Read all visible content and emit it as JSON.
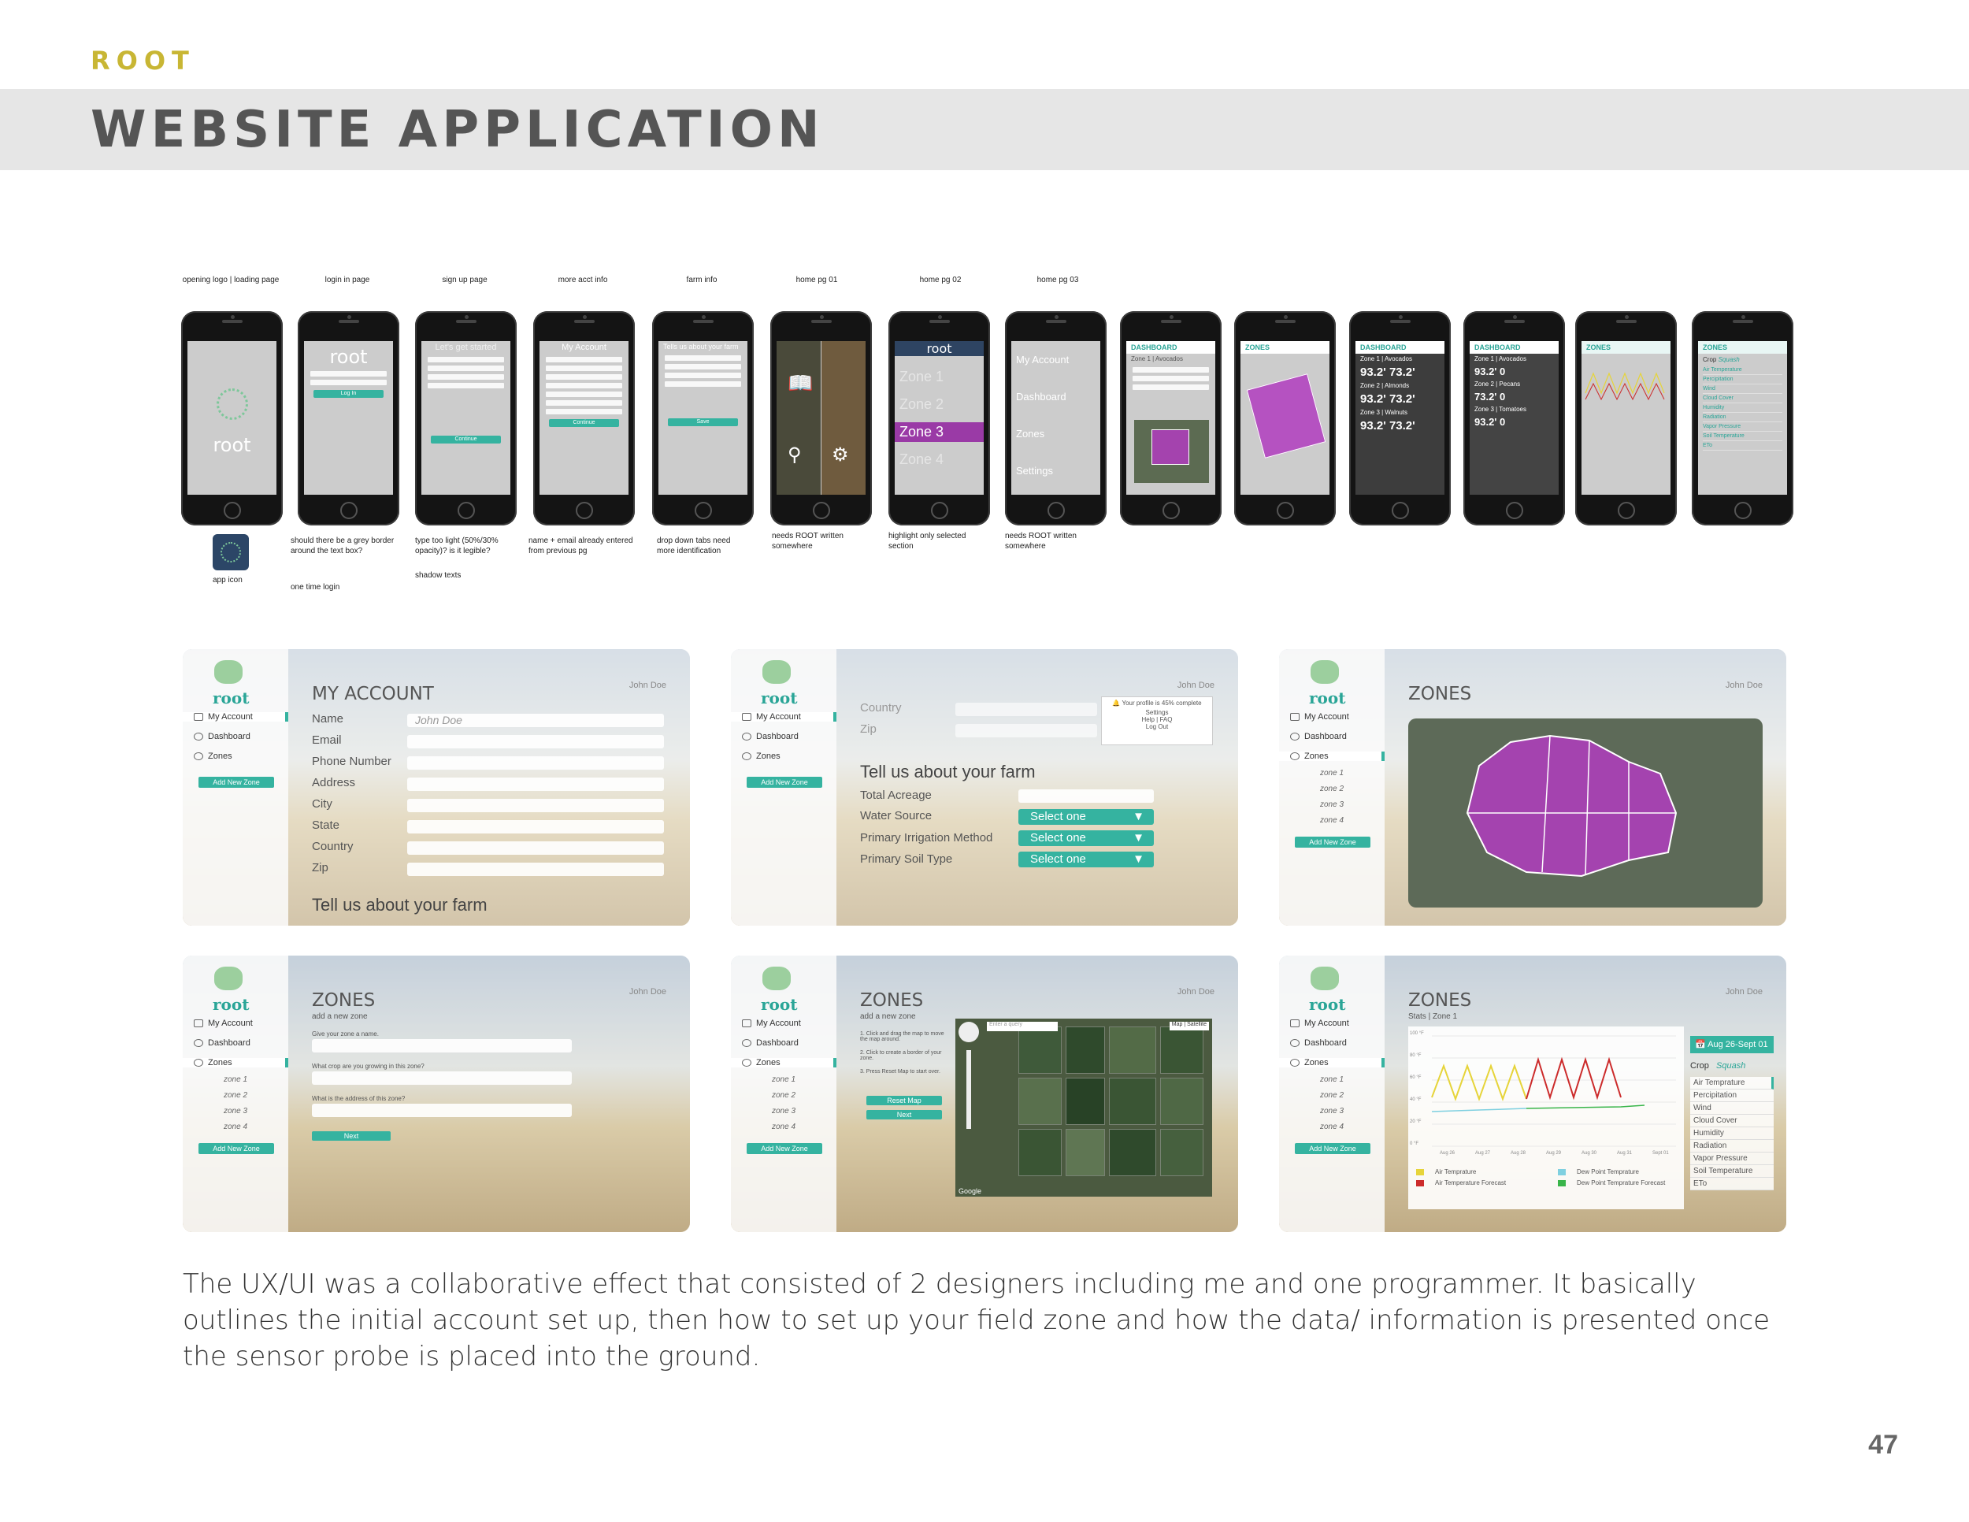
{
  "header": {
    "brand": "ROOT",
    "title": "WEBSITE APPLICATION"
  },
  "phones": [
    {
      "label": "opening logo | loading page",
      "screen": "root"
    },
    {
      "label": "login in page",
      "screen": "root"
    },
    {
      "label": "sign up page",
      "screen": "Let's get started"
    },
    {
      "label": "more acct info",
      "screen": "My Account"
    },
    {
      "label": "farm info",
      "screen": "Tells us about your farm"
    },
    {
      "label": "home pg 01",
      "screen": ""
    },
    {
      "label": "home pg 02",
      "screen": "root"
    },
    {
      "label": "home pg 03",
      "screen": "My Account"
    },
    {
      "label": "",
      "screen": "DASHBOARD"
    },
    {
      "label": "",
      "screen": "ZONES"
    },
    {
      "label": "",
      "screen": "DASHBOARD"
    },
    {
      "label": "",
      "screen": "DASHBOARD"
    },
    {
      "label": "",
      "screen": "ZONES"
    },
    {
      "label": "",
      "screen": "ZONES"
    }
  ],
  "phone_screen_text": {
    "login_button": "Log In",
    "continue": "Continue",
    "save": "Save",
    "zone1": "Zone 1",
    "zone2": "Zone 2",
    "zone3": "Zone 3",
    "zone4": "Zone 4",
    "dashboard": "Dashboard",
    "zones": "Zones",
    "settings": "Settings",
    "zone1_avocados": "Zone 1 | Avocados",
    "zone2_almonds": "Zone 2 | Almonds",
    "zone3_walnuts": "Zone 3 | Walnuts",
    "zone2_pecans": "Zone 2 | Pecans",
    "zone3_tomatoes": "Zone 3 | Tomatoes",
    "humidity_value": "93.2'",
    "temp_value": "73.2'",
    "zero_value": "0",
    "crop": "Crop",
    "squash": "Squash",
    "metrics": [
      "Air Temperature",
      "Percipitation",
      "Wind",
      "Cloud Cover",
      "Humidity",
      "Radiation",
      "Vapor Pressure",
      "Soil Temperature",
      "ETo"
    ]
  },
  "notes": {
    "app_icon": "app icon",
    "login_note": "should there be a grey border around the text box?",
    "login_note2": "one time login",
    "signup_note": "type too light (50%/30% opacity)? is it legible?",
    "signup_note2": "shadow texts",
    "acct_note": "name + email already entered from previous pg",
    "farm_note": "drop down tabs need more identification",
    "home1_note": "needs ROOT written somewhere",
    "home2_note": "highlight only selected section",
    "home3_note": "needs ROOT written somewhere"
  },
  "sidebar": {
    "brand": "root",
    "my_account": "My Account",
    "dashboard": "Dashboard",
    "zones": "Zones",
    "add_new_zone": "Add New Zone",
    "zone1": "zone 1",
    "zone2": "zone 2",
    "zone3": "zone 3",
    "zone4": "zone 4"
  },
  "user_name": "John Doe",
  "panel_account": {
    "title": "MY ACCOUNT",
    "fields": [
      "Name",
      "Email",
      "Phone Number",
      "Address",
      "City",
      "State",
      "Country",
      "Zip"
    ],
    "name_value": "John Doe",
    "footer": "Tell us about your farm"
  },
  "panel_farm": {
    "country": "Country",
    "zip": "Zip",
    "profile_popup": "Your profile is 45% complete",
    "menu": [
      "Settings",
      "Help | FAQ",
      "Log Out"
    ],
    "section": "Tell us about your farm",
    "total_acreage": "Total Acreage",
    "water_source": "Water Source",
    "irrigation": "Primary Irrigation Method",
    "soil": "Primary Soil Type",
    "select": "Select one"
  },
  "panel_zones": {
    "title": "ZONES"
  },
  "panel_add_zone": {
    "title": "ZONES",
    "subtitle": "add a new zone",
    "q1": "Give your zone a name.",
    "q2": "What crop are you growing in this zone?",
    "q3": "What is the address of this zone?",
    "next": "Next"
  },
  "panel_map": {
    "title": "ZONES",
    "subtitle": "add a new zone",
    "steps": [
      "1. Click and drag the map to move the map around.",
      "2. Click to create a border of your zone.",
      "3. Press Reset Map to start over."
    ],
    "reset_map": "Reset Map",
    "next": "Next",
    "search_placeholder": "Enter a query",
    "map": "Map",
    "satellite": "Satellite",
    "google": "Google"
  },
  "panel_stats": {
    "title": "ZONES",
    "subtitle": "Stats | Zone 1",
    "date": "Aug 26-Sept 01",
    "crop": "Crop",
    "crop_value": "Squash",
    "metrics": [
      "Air Temprature",
      "Percipitation",
      "Wind",
      "Cloud Cover",
      "Humidity",
      "Radiation",
      "Vapor Pressure",
      "Soil Temperature",
      "ETo"
    ],
    "legend": [
      "Air Temprature",
      "Air Temperature Forecast",
      "Dew Point Temprature",
      "Dew Point Temprature Forecast"
    ],
    "legend_colors": [
      "#e6d43a",
      "#cc2b2b",
      "#7fd0e0",
      "#39b54a"
    ],
    "y_ticks": [
      "100 °F",
      "80 °F",
      "60 °F",
      "40 °F",
      "20 °F",
      "0 °F"
    ],
    "x_ticks": [
      "Aug 26",
      "Aug 27",
      "Aug 28",
      "Aug 29",
      "Aug 30",
      "Aug 31",
      "Sept 01"
    ]
  },
  "body_text": "The UX/UI was a collaborative effect that consisted of 2 designers including me and one programmer. It basically outlines the initial account set up, then how to set up your field zone and how the data/ information is presented once the sensor probe is placed into the ground.",
  "page_number": "47",
  "colors": {
    "accent": "#35b3a0",
    "brand_gold": "#c8b634",
    "zone_purple": "#b03cbe"
  }
}
